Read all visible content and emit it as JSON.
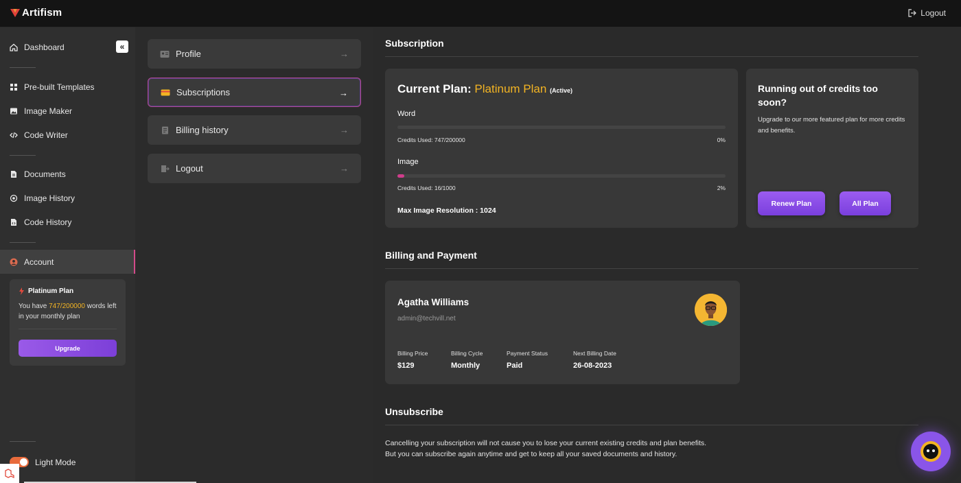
{
  "app": {
    "name": "Artifism",
    "logout_label": "Logout"
  },
  "sidebar": {
    "collapse_glyph": "«",
    "items": [
      {
        "label": "Dashboard",
        "icon": "home-icon"
      },
      {
        "label": "Pre-built Templates",
        "icon": "grid-icon"
      },
      {
        "label": "Image Maker",
        "icon": "image-icon"
      },
      {
        "label": "Code Writer",
        "icon": "code-icon"
      },
      {
        "label": "Documents",
        "icon": "document-icon"
      },
      {
        "label": "Image History",
        "icon": "history-icon"
      },
      {
        "label": "Code History",
        "icon": "code-file-icon"
      },
      {
        "label": "Account",
        "icon": "user-icon"
      }
    ],
    "plan": {
      "name": "Platinum Plan",
      "text_before": "You have ",
      "words": "747/200000",
      "text_after": " words left in your monthly plan",
      "upgrade_label": "Upgrade"
    },
    "light_mode_label": "Light Mode"
  },
  "account_menu": [
    {
      "label": "Profile",
      "icon": "profile-card-icon"
    },
    {
      "label": "Subscriptions",
      "icon": "credit-card-icon"
    },
    {
      "label": "Billing history",
      "icon": "receipt-icon"
    },
    {
      "label": "Logout",
      "icon": "logout-icon"
    }
  ],
  "subscription": {
    "section_title": "Subscription",
    "heading_prefix": "Current Plan:",
    "plan_name": "Platinum Plan",
    "plan_status": "(Active)",
    "word": {
      "label": "Word",
      "credits": "Credits Used: 747/200000",
      "percent": "0%",
      "fraction": 0.0
    },
    "image": {
      "label": "Image",
      "credits": "Credits Used: 16/1000",
      "percent": "2%",
      "fraction": 0.02
    },
    "max_resolution": "Max Image Resolution : 1024"
  },
  "promo": {
    "title": "Running out of credits too soon?",
    "text": "Upgrade to our more featured plan for more credits and benefits.",
    "renew_label": "Renew Plan",
    "all_label": "All Plan"
  },
  "billing": {
    "section_title": "Billing and Payment",
    "name": "Agatha Williams",
    "email": "admin@techvill.net",
    "fields": [
      {
        "key": "Billing Price",
        "value": "$129"
      },
      {
        "key": "Billing Cycle",
        "value": "Monthly"
      },
      {
        "key": "Payment Status",
        "value": "Paid"
      },
      {
        "key": "Next Billing Date",
        "value": "26-08-2023"
      }
    ]
  },
  "unsubscribe": {
    "section_title": "Unsubscribe",
    "text": "Cancelling your subscription will not cause you to lose your current existing credits and plan benefits. But you can subscribe again anytime and get to keep all your saved documents and history."
  },
  "colors": {
    "accent": "#f3b423",
    "purple": "#8a55e8",
    "pink": "#cf3d8b"
  }
}
